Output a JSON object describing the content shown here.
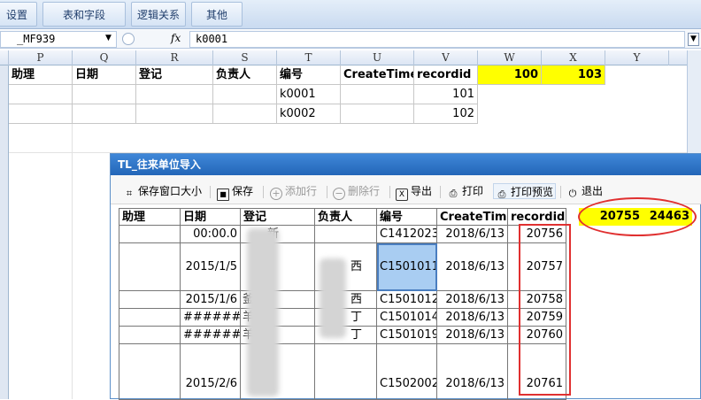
{
  "ribbon": {
    "tabs": [
      "设置",
      "表和字段",
      "逻辑关系",
      "其他"
    ]
  },
  "formula_bar": {
    "name_box": "_MF939",
    "fx": "fx",
    "formula": "k0001"
  },
  "sheet": {
    "columns": [
      "P",
      "Q",
      "R",
      "S",
      "T",
      "U",
      "V",
      "W",
      "X",
      "Y"
    ],
    "header_row": [
      "助理",
      "日期",
      "登记",
      "负责人",
      "编号",
      "CreateTime",
      "recordid",
      "100",
      "103"
    ],
    "rows": [
      {
        "T": "k0001",
        "V": "101"
      },
      {
        "T": "k0002",
        "V": "102"
      }
    ]
  },
  "dialog": {
    "title": "TL_往来单位导入",
    "toolbar": [
      {
        "icon": "save-window-size-icon",
        "label": "保存窗口大小",
        "enabled": true
      },
      {
        "icon": "save-icon",
        "label": "保存",
        "enabled": true
      },
      {
        "icon": "add-row-icon",
        "label": "添加行",
        "enabled": false
      },
      {
        "icon": "delete-row-icon",
        "label": "删除行",
        "enabled": false
      },
      {
        "icon": "export-icon",
        "label": "导出",
        "enabled": true
      },
      {
        "icon": "print-icon",
        "label": "打印",
        "enabled": true
      },
      {
        "icon": "print-preview-icon",
        "label": "打印预览",
        "enabled": true
      },
      {
        "icon": "exit-icon",
        "label": "退出",
        "enabled": true
      }
    ],
    "grid": {
      "headers": [
        "助理",
        "日期",
        "登记",
        "负责人",
        "编号",
        "CreateTime",
        "recordid"
      ],
      "summary": [
        "20755",
        "24463"
      ],
      "rows": [
        {
          "date": "00:00.0",
          "reg_partial": "新",
          "owner_partial": "",
          "no": "C1412023",
          "create": "2018/6/13",
          "rid": "20756"
        },
        {
          "date": "2015/1/5",
          "reg_partial": "",
          "owner_partial": "西",
          "no": "C1501011",
          "create": "2018/6/13",
          "rid": "20757"
        },
        {
          "date": "2015/1/6",
          "reg_partial": "釜",
          "owner_partial": "西",
          "no": "C1501012",
          "create": "2018/6/13",
          "rid": "20758"
        },
        {
          "date": "#######",
          "reg_partial": "羊",
          "owner_partial": "丁",
          "no": "C1501014",
          "create": "2018/6/13",
          "rid": "20759"
        },
        {
          "date": "#######",
          "reg_partial": "羊",
          "owner_partial": "丁",
          "no": "C1501019",
          "create": "2018/6/13",
          "rid": "20760"
        },
        {
          "date": "2015/2/6",
          "reg_partial": "",
          "owner_partial": "",
          "no": "C1502002",
          "create": "2018/6/13",
          "rid": "20761"
        }
      ]
    }
  },
  "colors": {
    "highlight_yellow": "#ffff00",
    "annotation_red": "#e03030",
    "dialog_title_blue": "#2366b8",
    "selected_cell": "#a9cdf2"
  }
}
